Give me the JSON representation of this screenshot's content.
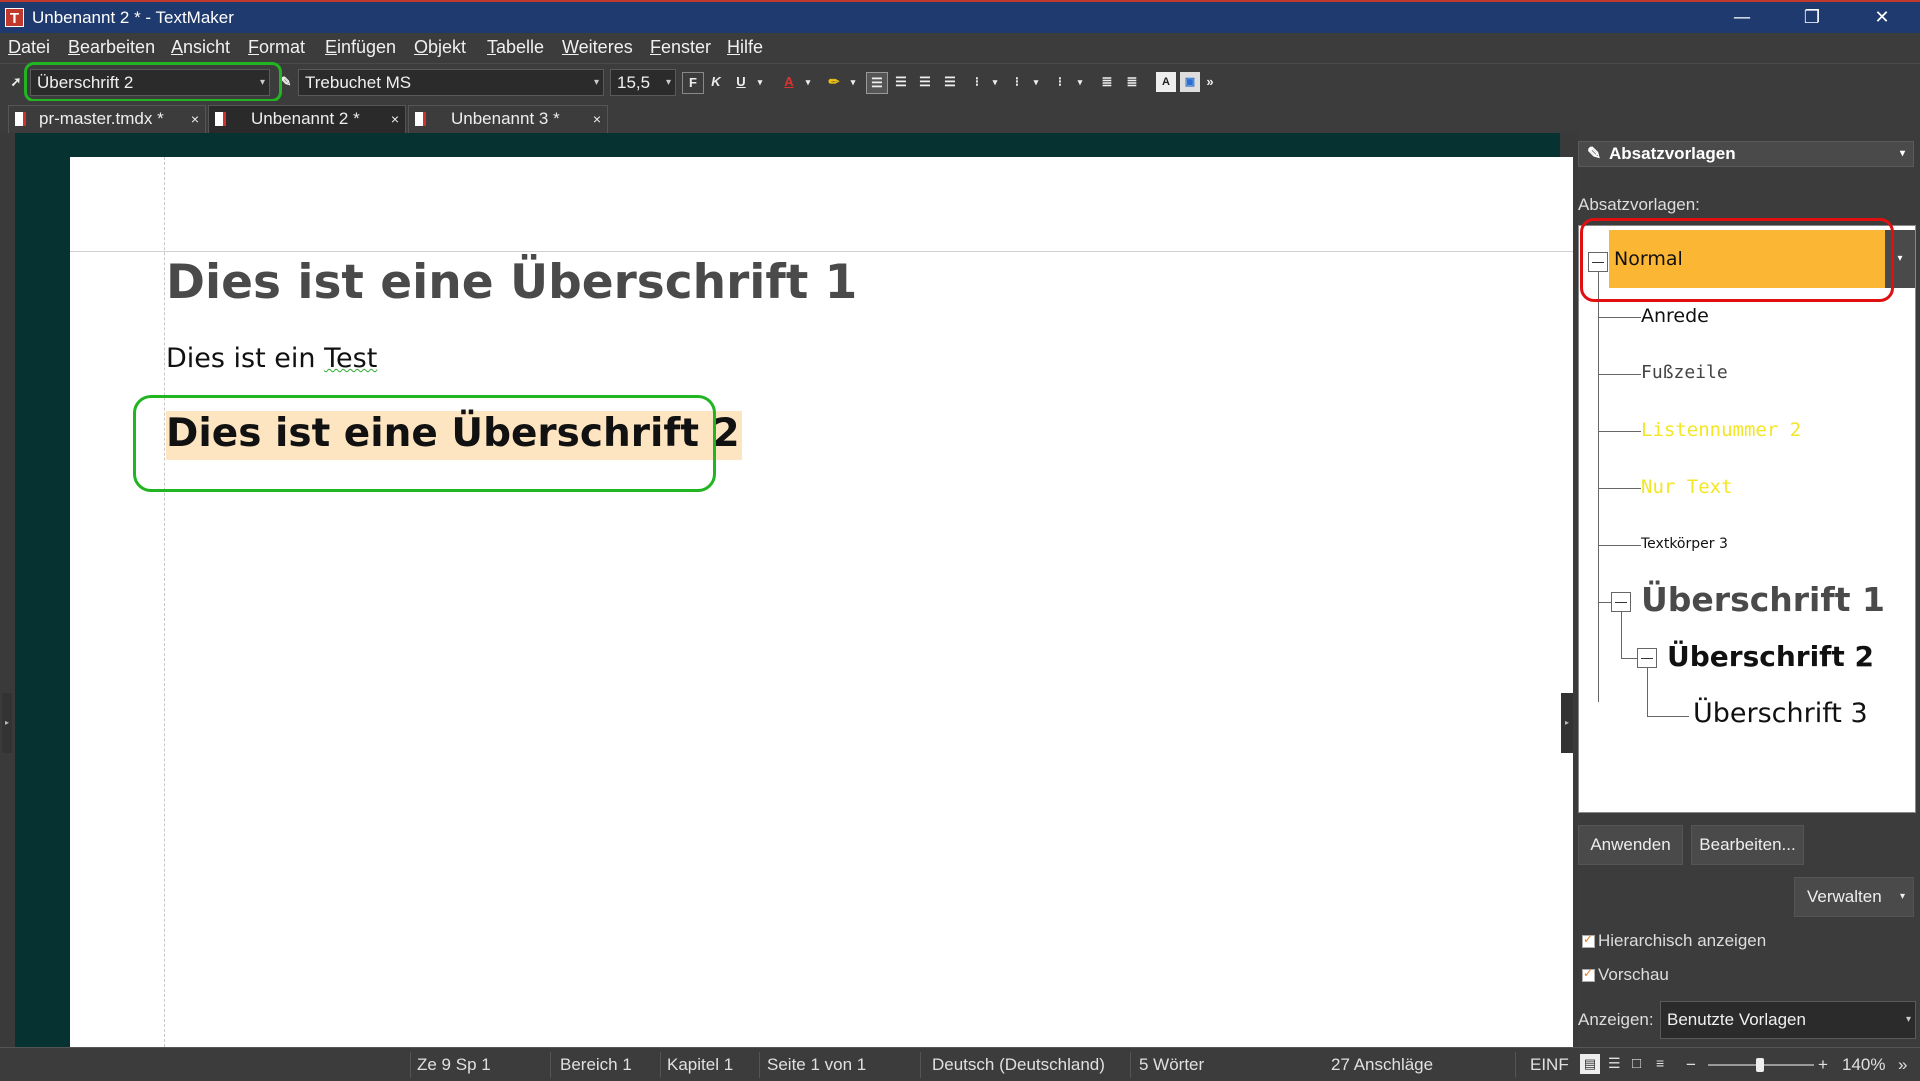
{
  "window": {
    "title": "Unbenannt 2 * - TextMaker",
    "app_icon": "T"
  },
  "menu": [
    "Datei",
    "Bearbeiten",
    "Ansicht",
    "Format",
    "Einfügen",
    "Objekt",
    "Tabelle",
    "Weiteres",
    "Fenster",
    "Hilfe"
  ],
  "toolbar": {
    "paragraph_style": "Überschrift 2",
    "font": "Trebuchet MS",
    "font_size": "15,5",
    "bold_label": "F",
    "italic_label": "K",
    "underline_label": "U",
    "font_color_label": "A",
    "more_label": "»"
  },
  "tabs": [
    {
      "label": "pr-master.tmdx *",
      "close": "×"
    },
    {
      "label": "Unbenannt 2 *",
      "close": "×"
    },
    {
      "label": "Unbenannt 3 *",
      "close": "×"
    }
  ],
  "document": {
    "heading1": "Dies ist eine Überschrift 1",
    "body_prefix": "Dies ist ein ",
    "body_word": "Test",
    "heading2": "Dies ist eine Überschrift 2"
  },
  "panel": {
    "title": "Absatzvorlagen",
    "list_label": "Absatzvorlagen:",
    "styles": [
      "Normal",
      "Anrede",
      "Fußzeile",
      "Listennummer 2",
      "Nur Text",
      "Textkörper 3",
      "Überschrift 1",
      "Überschrift 2",
      "Überschrift 3"
    ],
    "selected_style": "Normal",
    "apply_button": "Anwenden",
    "edit_button": "Bearbeiten...",
    "manage_button": "Verwalten",
    "show_hierarchical": "Hierarchisch anzeigen",
    "preview": "Vorschau",
    "show_label": "Anzeigen:",
    "show_value": "Benutzte Vorlagen"
  },
  "status": {
    "position": "Ze 9 Sp 1",
    "section": "Bereich 1",
    "chapter": "Kapitel 1",
    "page": "Seite 1 von 1",
    "language": "Deutsch (Deutschland)",
    "words": "5 Wörter",
    "chars": "27 Anschläge",
    "mode": "EINF",
    "zoom": "140%"
  },
  "colors": {
    "accent_orange": "#fbb733",
    "highlight": "#fde5c2",
    "annotation_green": "#21b521",
    "annotation_red": "#e01010"
  }
}
